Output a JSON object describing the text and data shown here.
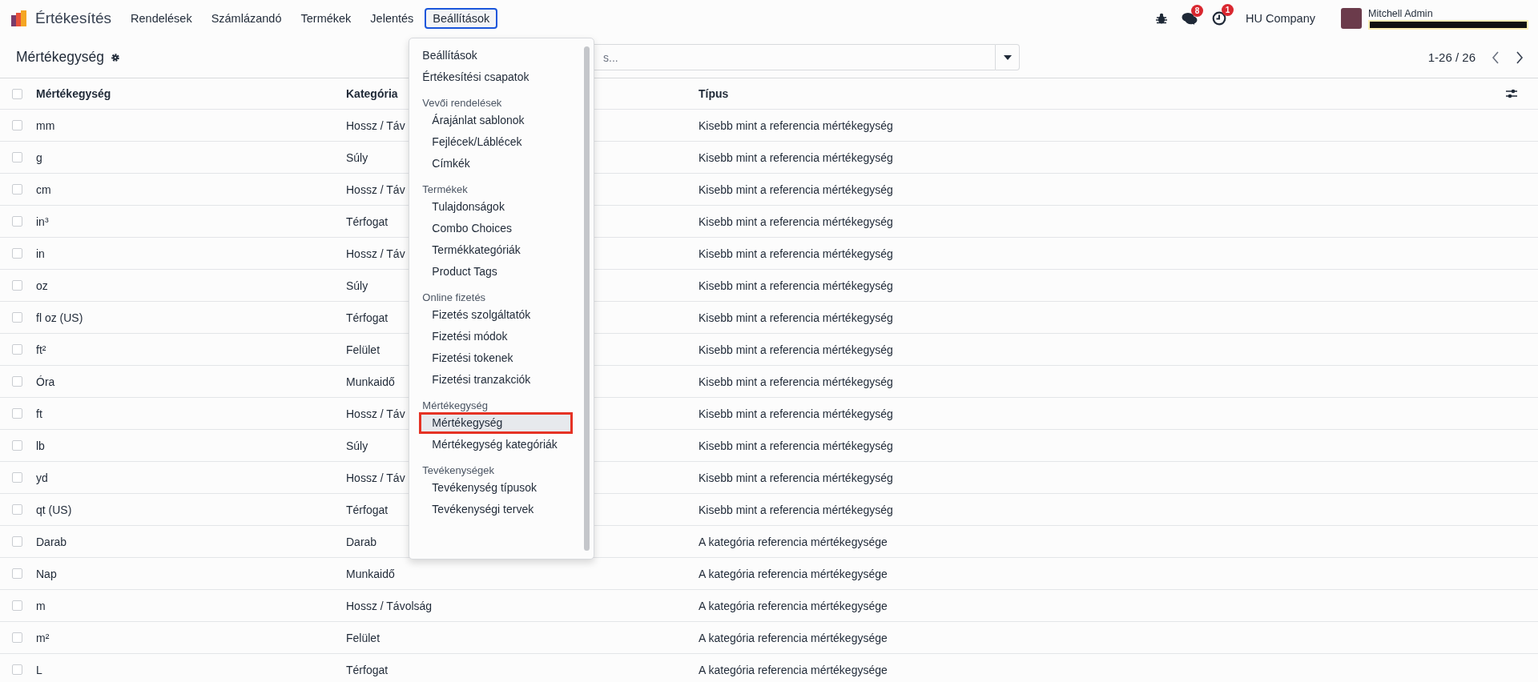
{
  "app": {
    "name": "Értékesítés"
  },
  "menu": [
    {
      "label": "Rendelések",
      "selected": false
    },
    {
      "label": "Számlázandó",
      "selected": false
    },
    {
      "label": "Termékek",
      "selected": false
    },
    {
      "label": "Jelentés",
      "selected": false
    },
    {
      "label": "Beállítások",
      "selected": true
    }
  ],
  "systray": {
    "messages_count": "8",
    "activities_count": "1",
    "company": "HU Company",
    "user": "Mitchell Admin"
  },
  "control_panel": {
    "title": "Mértékegység",
    "search": {
      "placeholder": "s..."
    },
    "pager": "1-26 / 26"
  },
  "table": {
    "select_all_checked": false,
    "columns": [
      "Mértékegység",
      "Kategória",
      "Típus"
    ],
    "rows": [
      {
        "checked": false,
        "cells": [
          "mm",
          "Hossz / Táv",
          "Kisebb mint a referencia mértékegység"
        ]
      },
      {
        "checked": false,
        "cells": [
          "g",
          "Súly",
          "Kisebb mint a referencia mértékegység"
        ]
      },
      {
        "checked": false,
        "cells": [
          "cm",
          "Hossz / Táv",
          "Kisebb mint a referencia mértékegység"
        ]
      },
      {
        "checked": false,
        "cells": [
          "in³",
          "Térfogat",
          "Kisebb mint a referencia mértékegység"
        ]
      },
      {
        "checked": false,
        "cells": [
          "in",
          "Hossz / Táv",
          "Kisebb mint a referencia mértékegység"
        ]
      },
      {
        "checked": false,
        "cells": [
          "oz",
          "Súly",
          "Kisebb mint a referencia mértékegység"
        ]
      },
      {
        "checked": false,
        "cells": [
          "fl oz (US)",
          "Térfogat",
          "Kisebb mint a referencia mértékegység"
        ]
      },
      {
        "checked": false,
        "cells": [
          "ft²",
          "Felület",
          "Kisebb mint a referencia mértékegység"
        ]
      },
      {
        "checked": false,
        "cells": [
          "Óra",
          "Munkaidő",
          "Kisebb mint a referencia mértékegység"
        ]
      },
      {
        "checked": false,
        "cells": [
          "ft",
          "Hossz / Táv",
          "Kisebb mint a referencia mértékegység"
        ]
      },
      {
        "checked": false,
        "cells": [
          "lb",
          "Súly",
          "Kisebb mint a referencia mértékegység"
        ]
      },
      {
        "checked": false,
        "cells": [
          "yd",
          "Hossz / Táv",
          "Kisebb mint a referencia mértékegység"
        ]
      },
      {
        "checked": false,
        "cells": [
          "qt (US)",
          "Térfogat",
          "Kisebb mint a referencia mértékegység"
        ]
      },
      {
        "checked": false,
        "cells": [
          "Darab",
          "Darab",
          "A kategória referencia mértékegysége"
        ]
      },
      {
        "checked": false,
        "cells": [
          "Nap",
          "Munkaidő",
          "A kategória referencia mértékegysége"
        ]
      },
      {
        "checked": false,
        "cells": [
          "m",
          "Hossz / Távolság",
          "A kategória referencia mértékegysége"
        ]
      },
      {
        "checked": false,
        "cells": [
          "m²",
          "Felület",
          "A kategória referencia mértékegysége"
        ]
      },
      {
        "checked": false,
        "cells": [
          "L",
          "Térfogat",
          "A kategória referencia mértékegysége"
        ]
      }
    ]
  },
  "dropdown": {
    "items": [
      {
        "kind": "item",
        "label": "Beállítások",
        "selected": false
      },
      {
        "kind": "item",
        "label": "Értékesítési csapatok",
        "selected": false
      },
      {
        "kind": "section",
        "label": "Vevői rendelések",
        "children": [
          {
            "label": "Árajánlat sablonok",
            "selected": false
          },
          {
            "label": "Fejlécek/Láblécek",
            "selected": false
          },
          {
            "label": "Címkék",
            "selected": false
          }
        ]
      },
      {
        "kind": "section",
        "label": "Termékek",
        "children": [
          {
            "label": "Tulajdonságok",
            "selected": false
          },
          {
            "label": "Combo Choices",
            "selected": false
          },
          {
            "label": "Termékkategóriák",
            "selected": false
          },
          {
            "label": "Product Tags",
            "selected": false
          }
        ]
      },
      {
        "kind": "section",
        "label": "Online fizetés",
        "children": [
          {
            "label": "Fizetés szolgáltatók",
            "selected": false
          },
          {
            "label": "Fizetési módok",
            "selected": false
          },
          {
            "label": "Fizetési tokenek",
            "selected": false
          },
          {
            "label": "Fizetési tranzakciók",
            "selected": false
          }
        ]
      },
      {
        "kind": "section",
        "label": "Mértékegység",
        "children": [
          {
            "label": "Mértékegység",
            "selected": true
          },
          {
            "label": "Mértékegység kategóriák",
            "selected": false
          }
        ]
      },
      {
        "kind": "section",
        "label": "Tevékenységek",
        "children": [
          {
            "label": "Tevékenység típusok",
            "selected": false
          },
          {
            "label": "Tevékenységi tervek",
            "selected": false
          }
        ]
      }
    ]
  }
}
